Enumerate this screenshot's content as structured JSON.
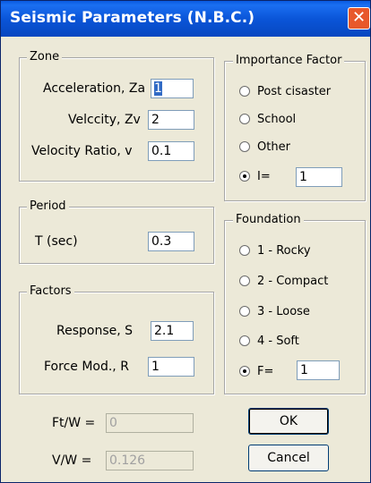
{
  "window": {
    "title": "Seismic Parameters (N.B.C.)",
    "close_glyph": "✕"
  },
  "zone": {
    "legend": "Zone",
    "acceleration_label": "Acceleration, Za",
    "acceleration_value": "1",
    "velocity_label": "Velccity, Zv",
    "velocity_value": "2",
    "velocity_ratio_label": "Velocity Ratio, v",
    "velocity_ratio_value": "0.1"
  },
  "period": {
    "legend": "Period",
    "t_label": "T (sec)",
    "t_value": "0.3"
  },
  "factors": {
    "legend": "Factors",
    "response_label": "Response, S",
    "response_value": "2.1",
    "force_label": "Force Mod., R",
    "force_value": "1"
  },
  "importance": {
    "legend": "Importance Factor",
    "options": [
      "Post cisaster",
      "School",
      "Other",
      "I="
    ],
    "selected_index": 3,
    "i_value": "1"
  },
  "foundation": {
    "legend": "Foundation",
    "options": [
      "1 - Rocky",
      "2 - Compact",
      "3 - Loose",
      "4 - Soft",
      "F="
    ],
    "selected_index": 4,
    "f_value": "1"
  },
  "results": {
    "ft_label": "Ft/W =",
    "ft_value": "0",
    "v_label": "V/W =",
    "v_value": "0.126"
  },
  "buttons": {
    "ok": "OK",
    "cancel": "Cancel"
  }
}
